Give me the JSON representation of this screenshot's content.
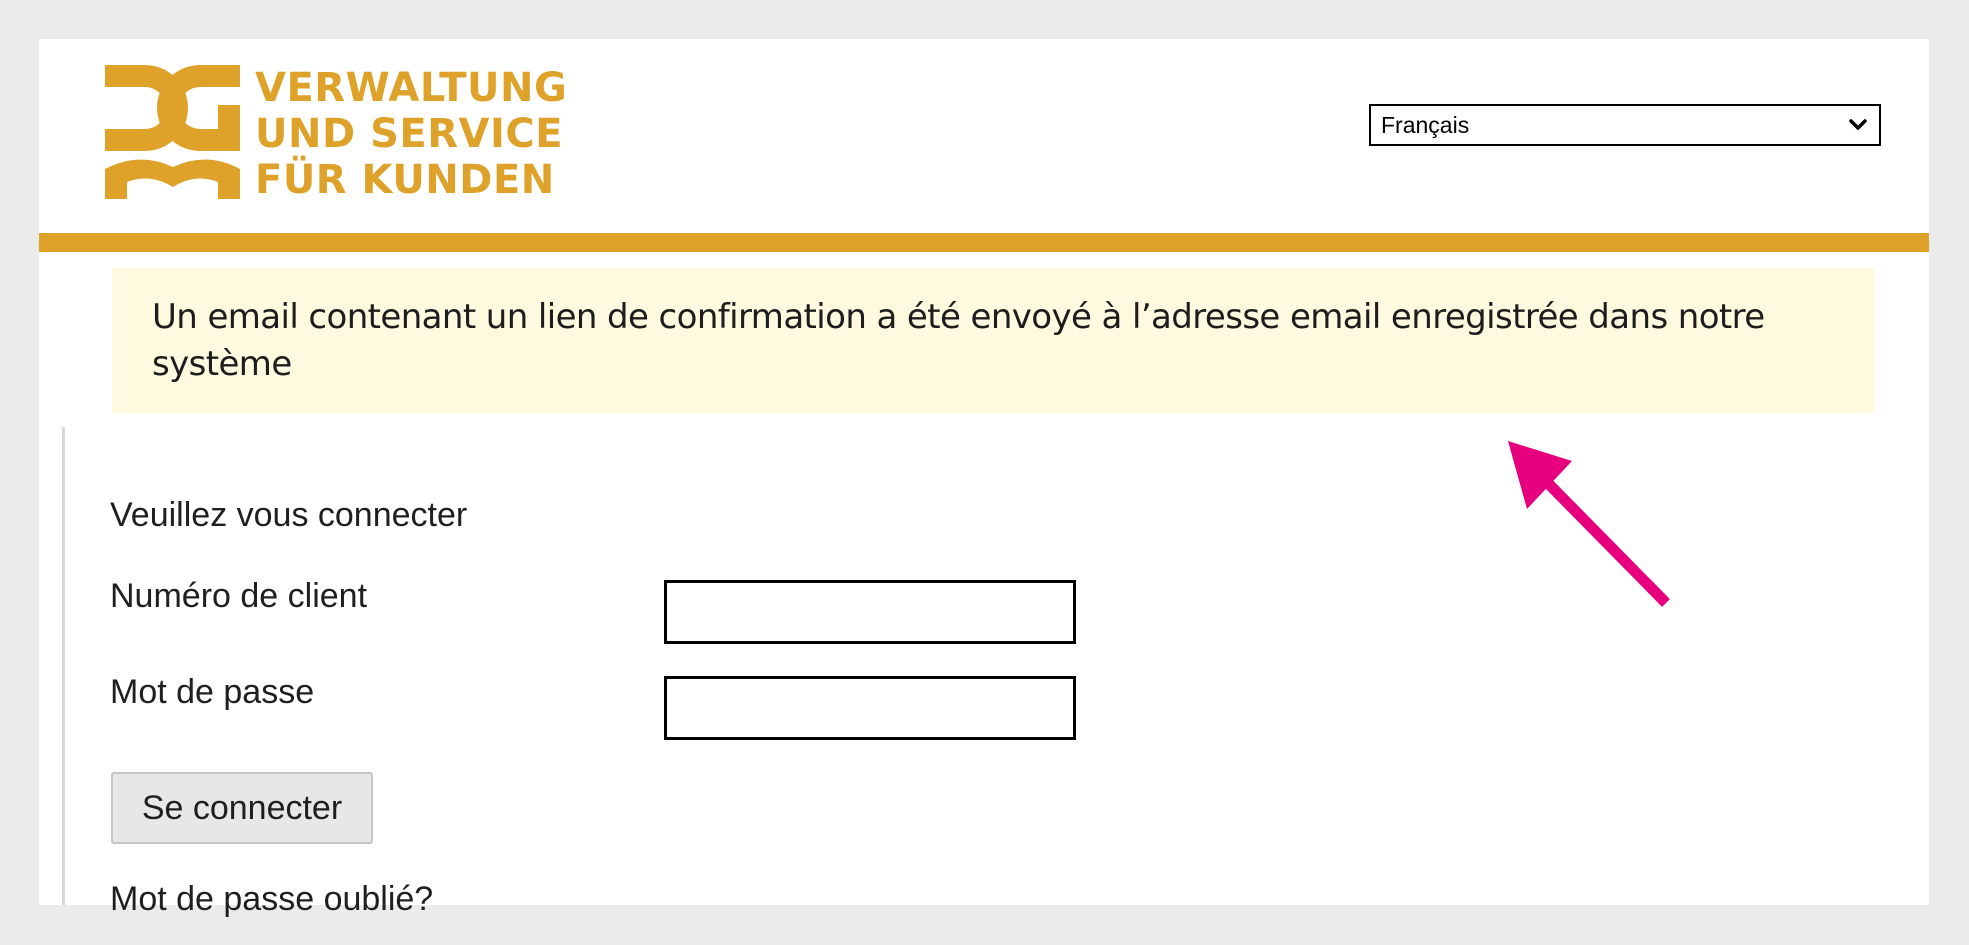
{
  "brand": {
    "logo_lines": [
      "VERWALTUNG",
      "UND SERVICE",
      "FÜR KUNDEN"
    ],
    "logo_icon": "dg-monogram-icon",
    "color": "#dea22b"
  },
  "language": {
    "selected": "Français",
    "icon": "chevron-down-icon"
  },
  "notice": {
    "message": "Un email contenant un lien de confirmation a été envoyé à l’adresse email enregistrée dans notre système",
    "background": "#fef9df"
  },
  "login": {
    "heading": "Veuillez vous connecter",
    "customer_number_label": "Numéro de client",
    "customer_number_value": "",
    "password_label": "Mot de passe",
    "password_value": "",
    "submit_label": "Se connecter",
    "forgot_password_label": "Mot de passe oublié?"
  },
  "annotation": {
    "icon": "arrow-icon",
    "color": "#e6007e"
  }
}
